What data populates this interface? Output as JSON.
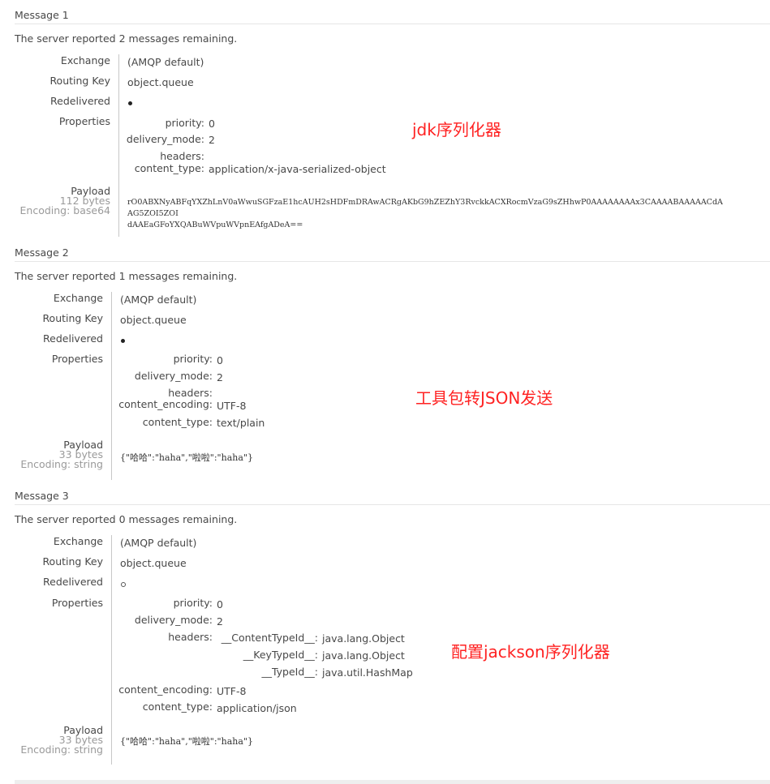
{
  "labels": {
    "remaining_prefix": "The server reported",
    "remaining_suffix": "messages remaining.",
    "exchange": "Exchange",
    "routing_key": "Routing Key",
    "redelivered": "Redelivered",
    "properties": "Properties",
    "payload": "Payload"
  },
  "messages": [
    {
      "title": "Message 1",
      "remaining": "2",
      "exchange": "(AMQP default)",
      "routing_key": "object.queue",
      "redelivered": true,
      "properties": {
        "priority_key": "priority:",
        "priority": "0",
        "delivery_mode_key": "delivery_mode:",
        "delivery_mode": "2",
        "headers_key": "headers:",
        "content_type_key": "content_type:",
        "content_type": "application/x-java-serialized-object"
      },
      "payload_bytes": "112 bytes",
      "payload_encoding": "Encoding: base64",
      "payload_line1": "rO0ABXNyABFqYXZhLnV0aWwuSGFzaE1hcAUH2sHDFmDRAwACRgAKbG9hZEZhY3RvckkACXRocmVzaG9sZHhwP0AAAAAAAAx3CAAAABAAAAACdAAG5ZOI5ZOI",
      "payload_line2": "dAAEaGFoYXQABuWVpuWVpnEAfgADeA=="
    },
    {
      "title": "Message 2",
      "remaining": "1",
      "exchange": "(AMQP default)",
      "routing_key": "object.queue",
      "redelivered": true,
      "properties": {
        "priority_key": "priority:",
        "priority": "0",
        "delivery_mode_key": "delivery_mode:",
        "delivery_mode": "2",
        "headers_key": "headers:",
        "content_encoding_key": "content_encoding:",
        "content_encoding": "UTF-8",
        "content_type_key": "content_type:",
        "content_type": "text/plain"
      },
      "payload_bytes": "33 bytes",
      "payload_encoding": "Encoding: string",
      "payload_line1": "{\"哈哈\":\"haha\",\"啦啦\":\"haha\"}"
    },
    {
      "title": "Message 3",
      "remaining": "0",
      "exchange": "(AMQP default)",
      "routing_key": "object.queue",
      "redelivered": false,
      "properties": {
        "priority_key": "priority:",
        "priority": "0",
        "delivery_mode_key": "delivery_mode:",
        "delivery_mode": "2",
        "headers_key": "headers:",
        "header1_key": "__ContentTypeId__:",
        "header1_val": "java.lang.Object",
        "header2_key": "__KeyTypeId__:",
        "header2_val": "java.lang.Object",
        "header3_key": "__TypeId__:",
        "header3_val": "java.util.HashMap",
        "content_encoding_key": "content_encoding:",
        "content_encoding": "UTF-8",
        "content_type_key": "content_type:",
        "content_type": "application/json"
      },
      "payload_bytes": "33 bytes",
      "payload_encoding": "Encoding: string",
      "payload_line1": "{\"哈哈\":\"haha\",\"啦啦\":\"haha\"}"
    }
  ],
  "annotations": {
    "a1": "jdk序列化器",
    "a2": "工具包转JSON发送",
    "a3": "配置jackson序列化器"
  },
  "colors": {
    "annotation": "#ff2222",
    "muted": "#9a9a9a",
    "divider": "#c8c8c8"
  }
}
